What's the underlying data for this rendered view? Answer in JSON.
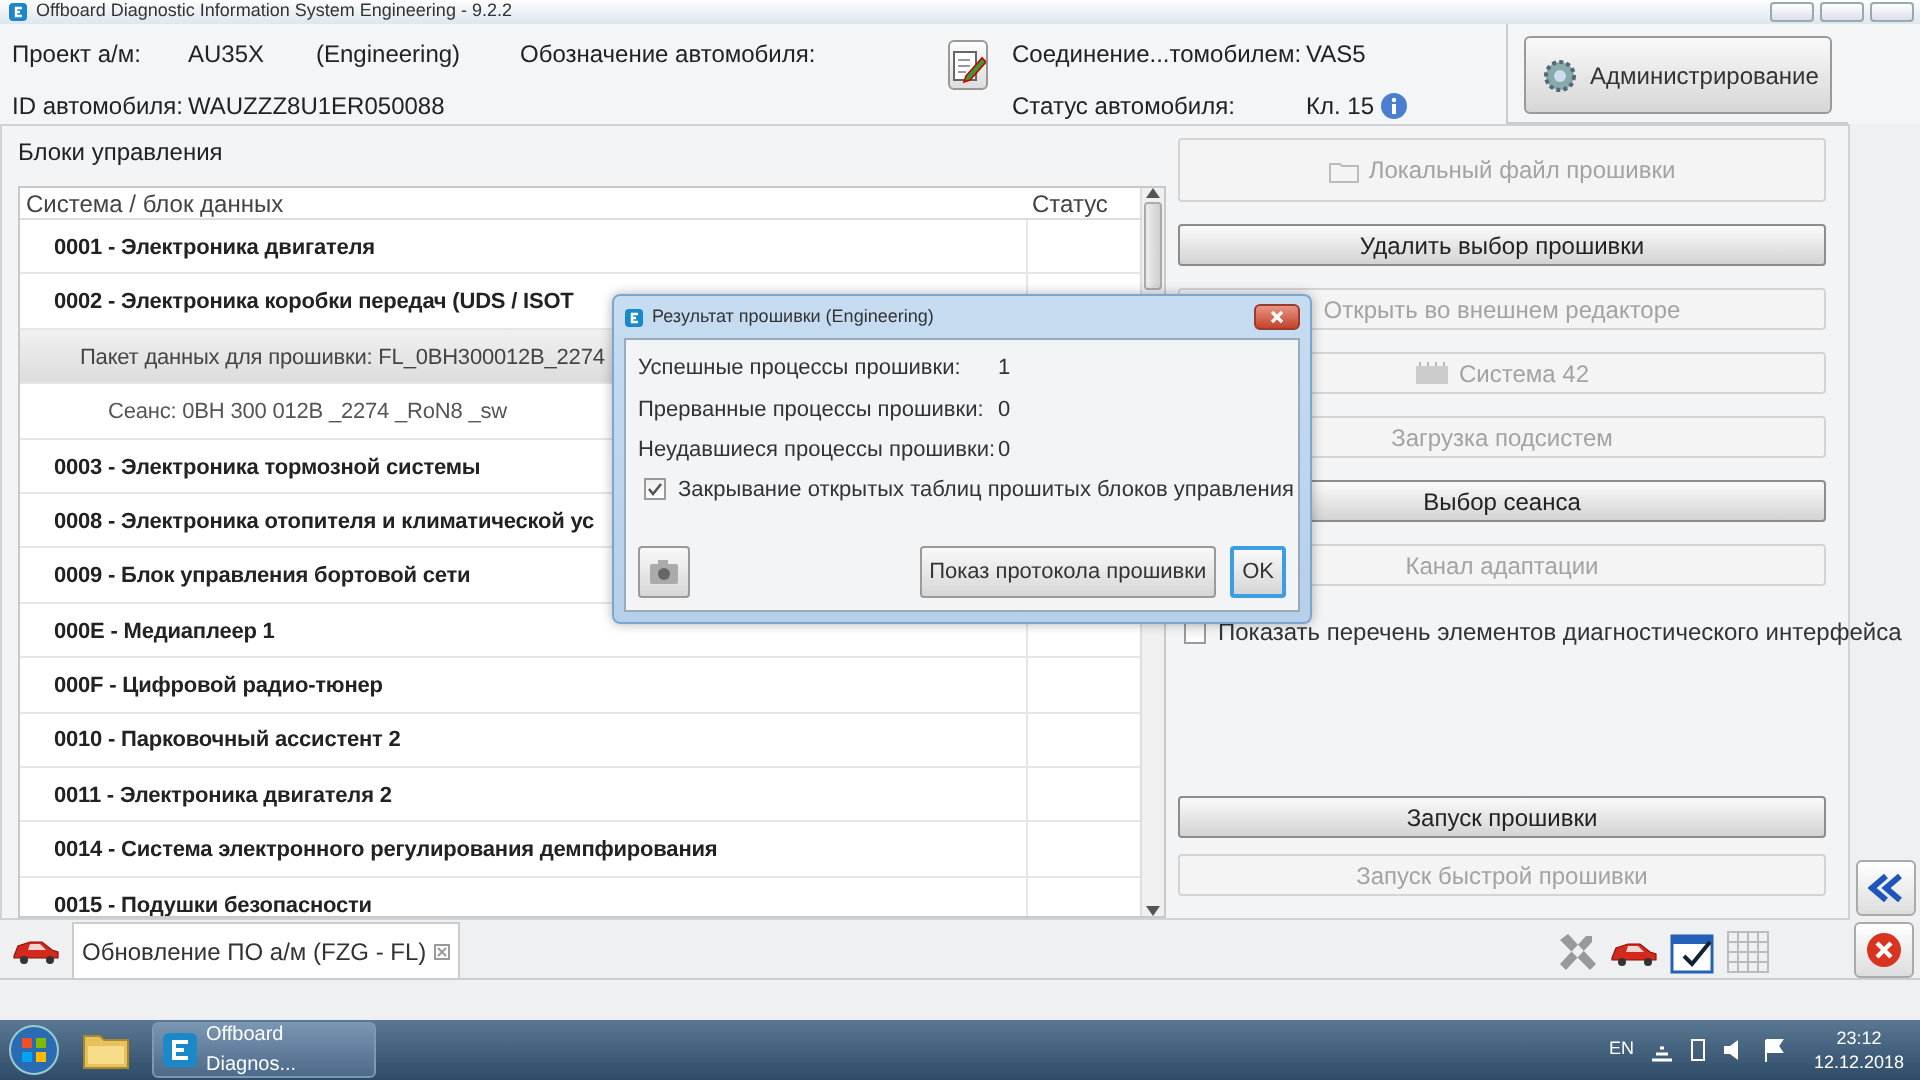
{
  "window": {
    "title": "Offboard Diagnostic Information System Engineering - 9.2.2"
  },
  "header": {
    "project_label": "Проект а/м:",
    "project_value": "AU35X",
    "project_mode": "(Engineering)",
    "designation_label": "Обозначение автомобиля:",
    "id_label": "ID автомобиля:",
    "id_value": "WAUZZZ8U1ER050088",
    "connection_label": "Соединение...томобилем:",
    "connection_value": "VAS5",
    "status_label": "Статус автомобиля:",
    "status_value": "Кл. 15",
    "admin_button": "Администрирование"
  },
  "control_units": {
    "title": "Блоки управления",
    "columns": [
      "Система / блок данных",
      "Статус"
    ],
    "rows": [
      {
        "kind": "unit",
        "text": "0001 - Электроника двигателя",
        "selected": false
      },
      {
        "kind": "unit",
        "text": "0002 - Электроника коробки передач  (UDS / ISOT",
        "selected": false
      },
      {
        "kind": "package",
        "text": "Пакет данных для прошивки: FL_0BH300012B_2274",
        "selected": true
      },
      {
        "kind": "session",
        "text": "Сеанс: 0BH 300 012B _2274 _RoN8 _sw",
        "selected": false
      },
      {
        "kind": "unit",
        "text": "0003 - Электроника тормозной системы",
        "selected": false
      },
      {
        "kind": "unit",
        "text": "0008 - Электроника отопителя и климатической ус",
        "selected": false
      },
      {
        "kind": "unit",
        "text": "0009 - Блок управления бортовой сети",
        "selected": false
      },
      {
        "kind": "unit",
        "text": "000E - Медиаплеер 1",
        "selected": false
      },
      {
        "kind": "unit",
        "text": "000F - Цифровой радио-тюнер",
        "selected": false
      },
      {
        "kind": "unit",
        "text": "0010 - Парковочный ассистент 2",
        "selected": false
      },
      {
        "kind": "unit",
        "text": "0011 - Электроника двигателя 2",
        "selected": false
      },
      {
        "kind": "unit",
        "text": "0014 - Система электронного регулирования демпфирования",
        "selected": false
      },
      {
        "kind": "unit",
        "text": "0015 - Подушки безопасности",
        "selected": false
      }
    ]
  },
  "actions": [
    {
      "kind": "folder",
      "label": "Локальный файл прошивки",
      "disabled": true
    },
    {
      "kind": "plain",
      "label": "Удалить выбор прошивки",
      "disabled": false
    },
    {
      "kind": "plain",
      "label": "Открыть во внешнем редакторе",
      "disabled": true
    },
    {
      "kind": "system",
      "label": "Система 42",
      "disabled": true
    },
    {
      "kind": "plain",
      "label": "Загрузка подсистем",
      "disabled": true
    },
    {
      "kind": "plain",
      "label": "Выбор сеанса",
      "disabled": false
    },
    {
      "kind": "plain",
      "label": "Канал адаптации",
      "disabled": true
    }
  ],
  "interface_checkbox": {
    "label": "Показать перечень элементов диагностического интерфейса",
    "checked": false
  },
  "flash_actions": [
    {
      "label": "Запуск прошивки",
      "disabled": false
    },
    {
      "label": "Запуск быстрой прошивки",
      "disabled": true
    }
  ],
  "tab": {
    "label": "Обновление ПО а/м (FZG - FL)",
    "selected": true
  },
  "dialog": {
    "title": "Результат прошивки (Engineering)",
    "stats": [
      {
        "label": "Успешные процессы прошивки:",
        "value": "1"
      },
      {
        "label": "Прерванные процессы прошивки:",
        "value": "0"
      },
      {
        "label": "Неудавшиеся процессы прошивки:",
        "value": "0"
      }
    ],
    "close_tables": {
      "label": "Закрывание открытых таблиц прошитых блоков управления",
      "checked": true
    },
    "protocol_button": "Показ протокола прошивки",
    "ok_button": "OK"
  },
  "taskbar": {
    "app_label": "Offboard Diagnos...",
    "language": "EN",
    "time": "23:12",
    "date": "12.12.2018"
  }
}
